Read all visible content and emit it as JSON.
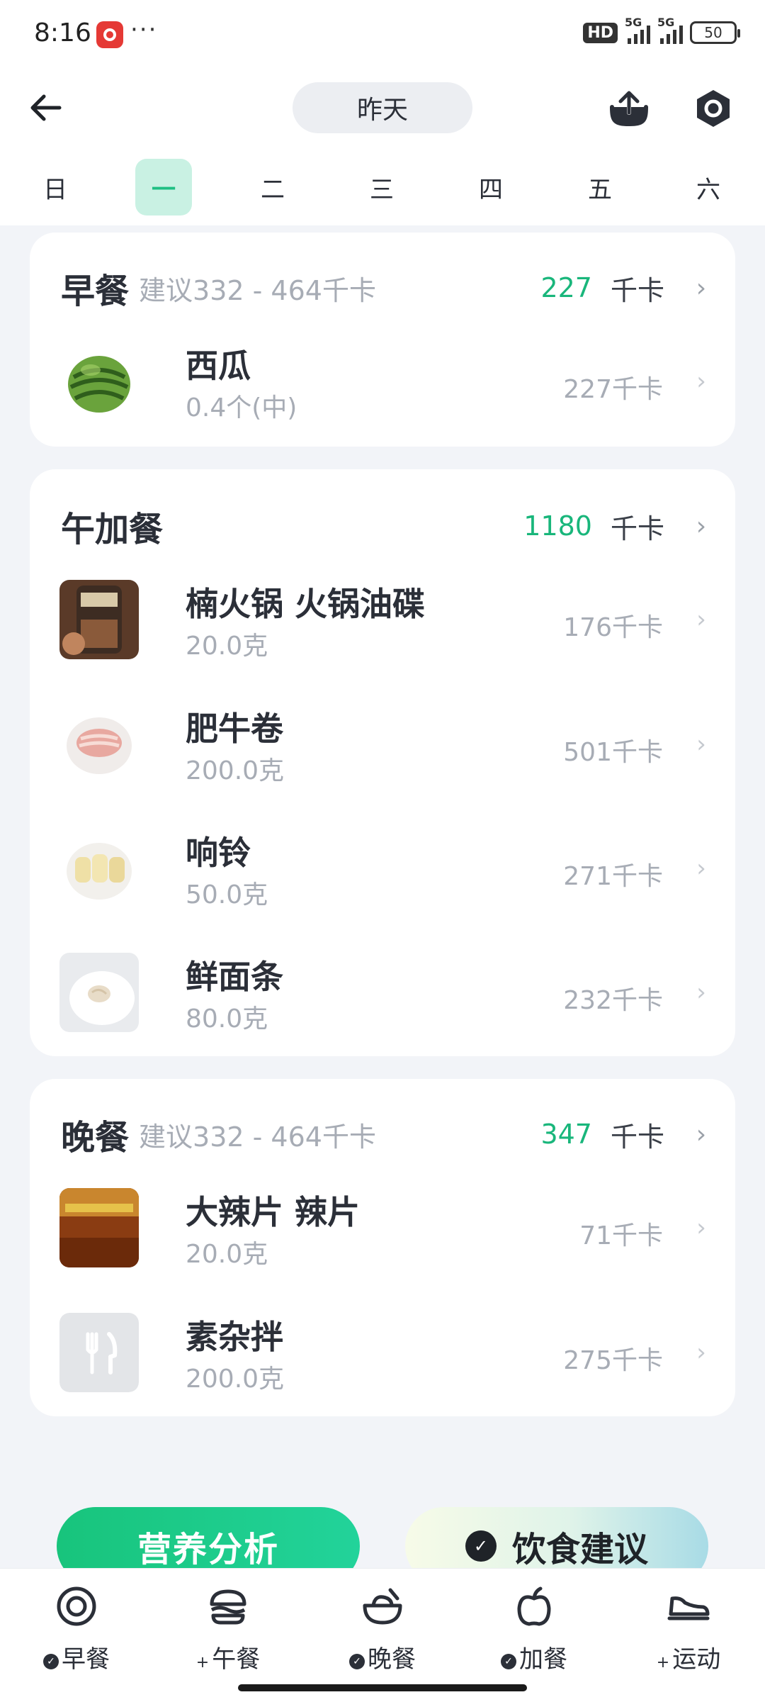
{
  "status": {
    "time": "8:16",
    "more": "···",
    "hd": "HD",
    "sig1": "5G",
    "sig2": "5G",
    "battery": "50"
  },
  "header": {
    "date": "昨天"
  },
  "week": [
    "日",
    "一",
    "二",
    "三",
    "四",
    "五",
    "六"
  ],
  "meals": {
    "breakfast": {
      "title": "早餐",
      "suggest": "建议332 - 464千卡",
      "calories": "227",
      "unit": "千卡",
      "items": [
        {
          "name": "西瓜",
          "amount": "0.4个(中)",
          "cal": "227千卡"
        }
      ]
    },
    "lunch_snack": {
      "title": "午加餐",
      "calories": "1180",
      "unit": "千卡",
      "items": [
        {
          "name": "楠火锅 火锅油碟",
          "amount": "20.0克",
          "cal": "176千卡"
        },
        {
          "name": "肥牛卷",
          "amount": "200.0克",
          "cal": "501千卡"
        },
        {
          "name": "响铃",
          "amount": "50.0克",
          "cal": "271千卡"
        },
        {
          "name": "鲜面条",
          "amount": "80.0克",
          "cal": "232千卡"
        }
      ]
    },
    "dinner": {
      "title": "晚餐",
      "suggest": "建议332 - 464千卡",
      "calories": "347",
      "unit": "千卡",
      "items": [
        {
          "name": "大辣片 辣片",
          "amount": "20.0克",
          "cal": "71千卡"
        },
        {
          "name": "素杂拌",
          "amount": "200.0克",
          "cal": "275千卡"
        }
      ]
    }
  },
  "actions": {
    "nutrition": "营养分析",
    "diet": "饮食建议"
  },
  "tabs": [
    {
      "label": "早餐",
      "mark": "✓"
    },
    {
      "label": "午餐",
      "mark": "+"
    },
    {
      "label": "晚餐",
      "mark": "✓"
    },
    {
      "label": "加餐",
      "mark": "✓"
    },
    {
      "label": "运动",
      "mark": "+"
    }
  ],
  "colors": {
    "accent": "#19b67b",
    "active_day_bg": "#c9f1e3",
    "page_bg": "#f2f4f8"
  }
}
